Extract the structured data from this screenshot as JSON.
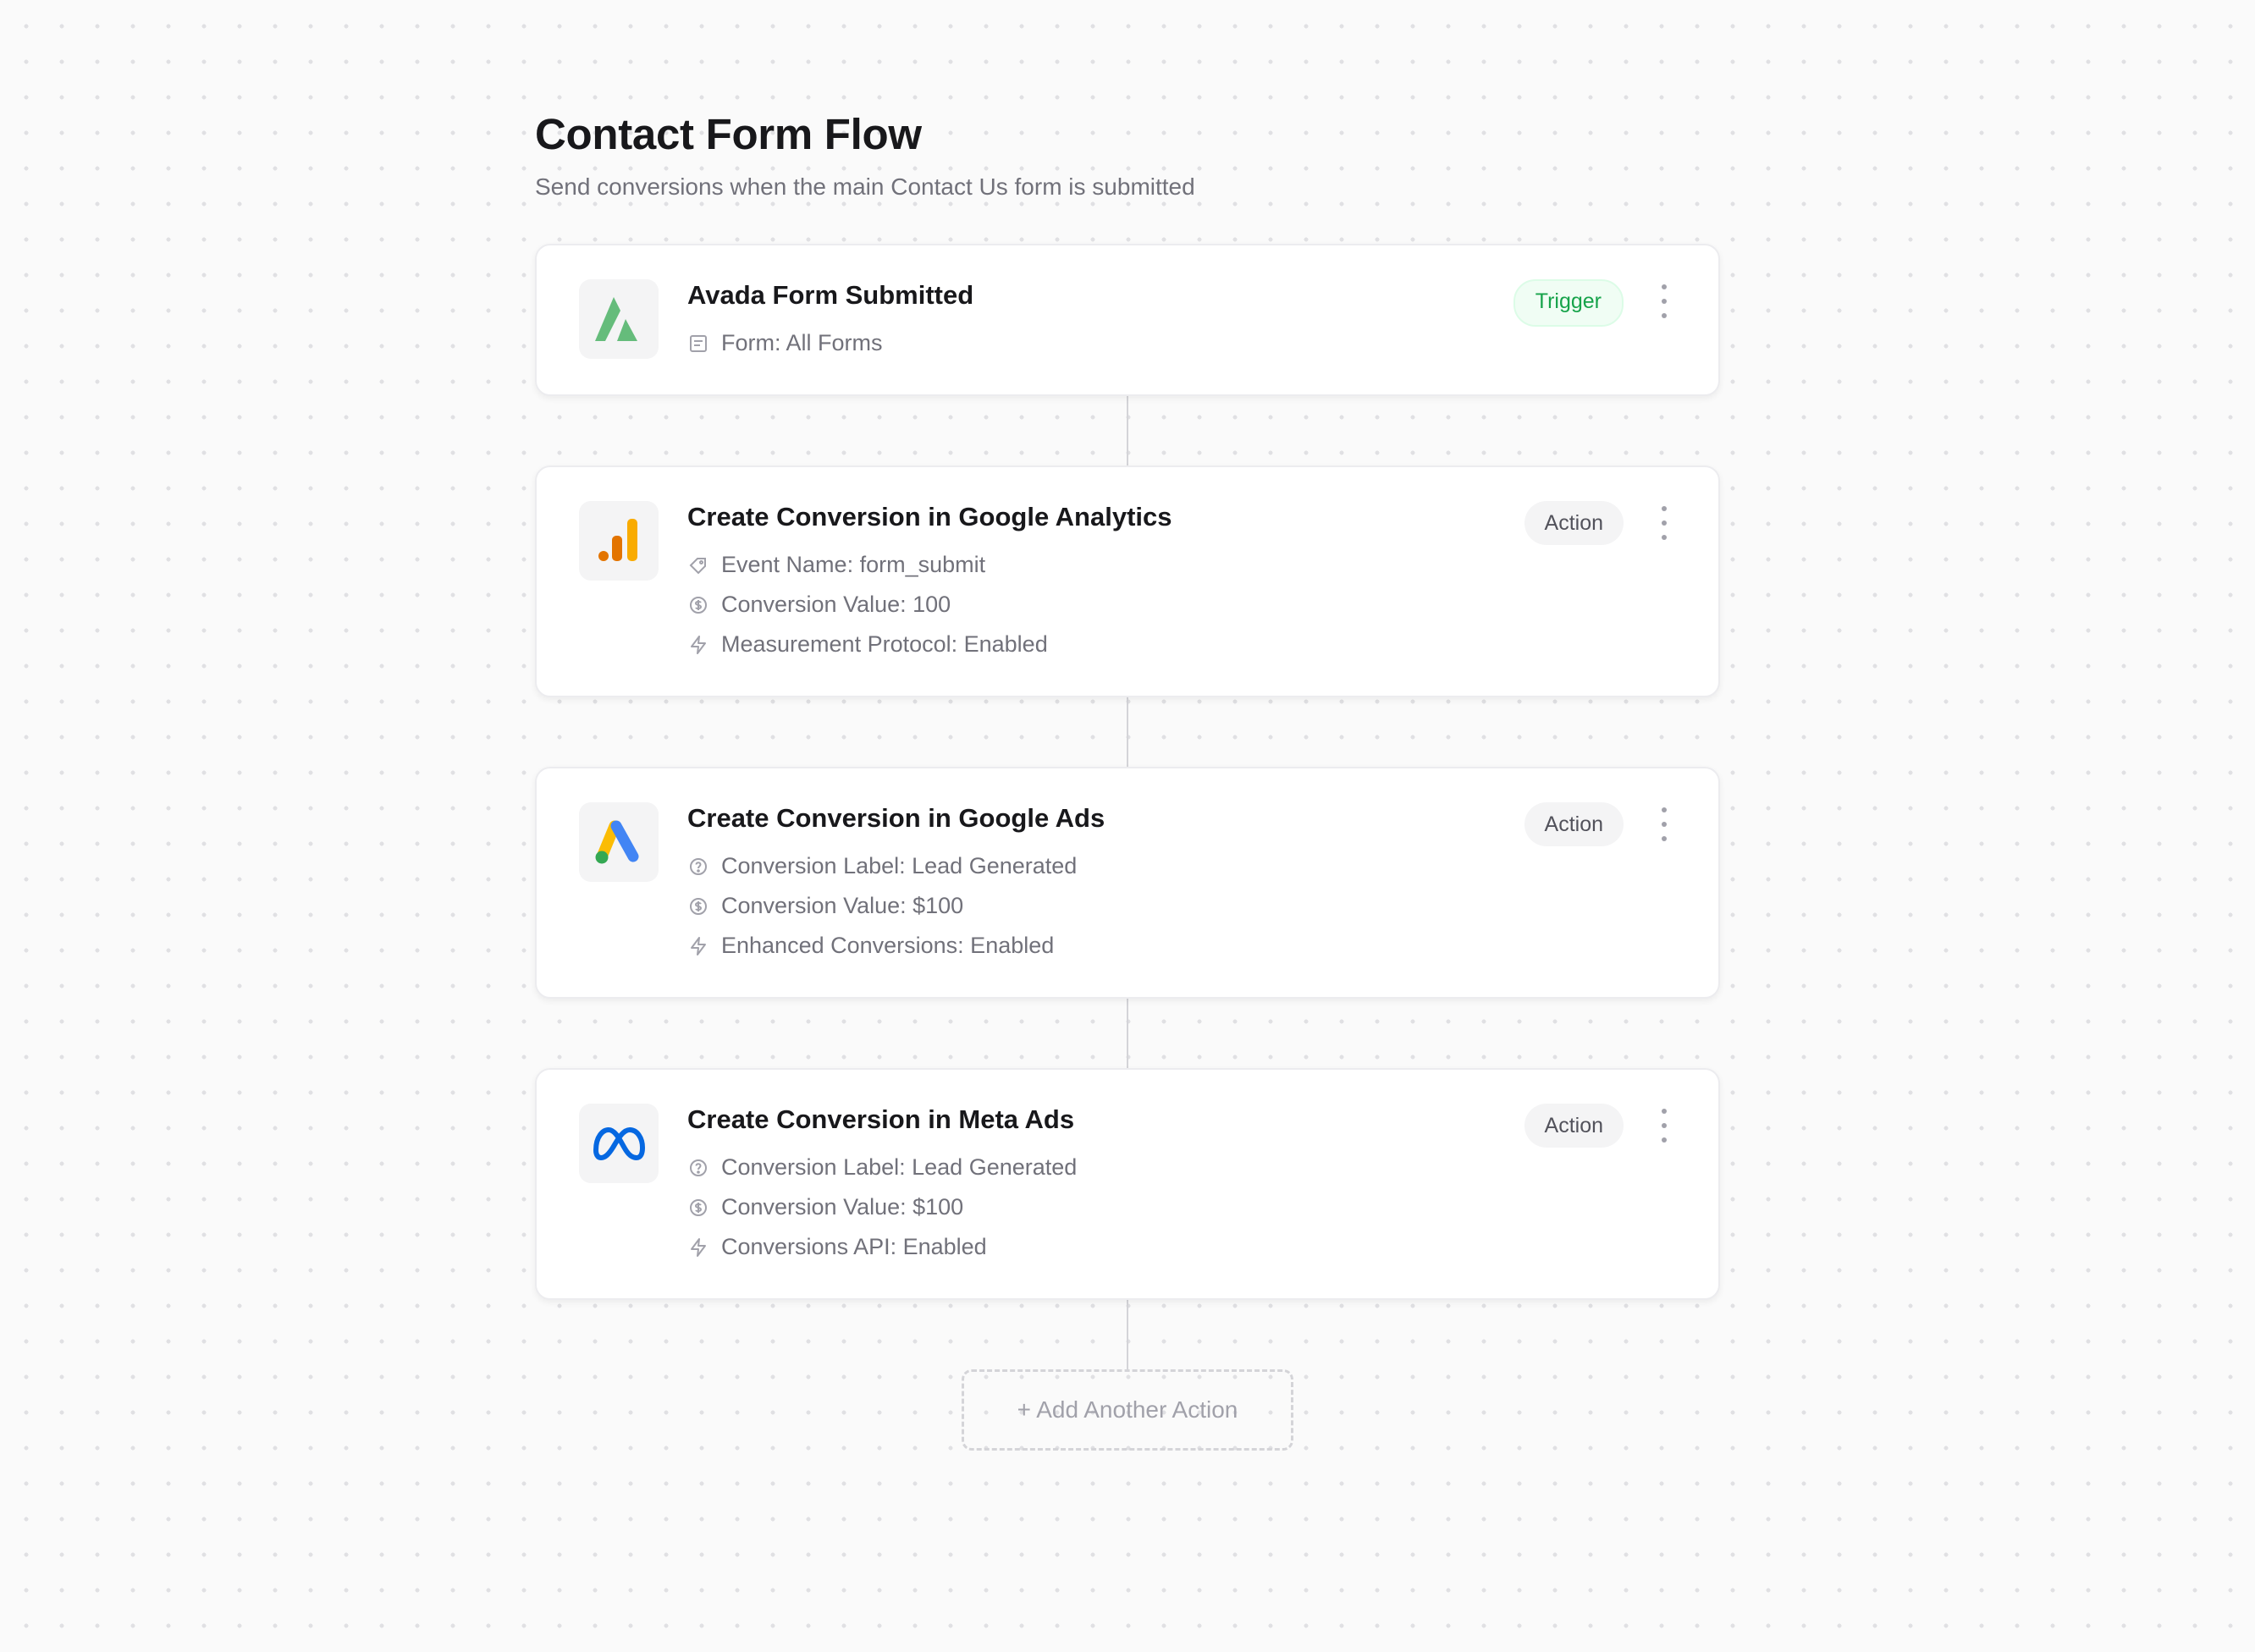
{
  "page": {
    "title": "Contact Form Flow",
    "subtitle": "Send conversions when the main Contact Us form is submitted"
  },
  "trigger": {
    "title": "Avada Form Submitted",
    "badge": "Trigger",
    "icon": "avada-logo-icon",
    "details": [
      {
        "icon": "form-icon",
        "text": "Form: All Forms"
      }
    ]
  },
  "actions": [
    {
      "title": "Create Conversion in Google Analytics",
      "badge": "Action",
      "icon": "google-analytics-logo-icon",
      "details": [
        {
          "icon": "tag-icon",
          "text": "Event Name: form_submit"
        },
        {
          "icon": "dollar-circle-icon",
          "text": "Conversion Value: 100"
        },
        {
          "icon": "lightning-icon",
          "text": "Measurement Protocol: Enabled"
        }
      ]
    },
    {
      "title": "Create Conversion in Google Ads",
      "badge": "Action",
      "icon": "google-ads-logo-icon",
      "details": [
        {
          "icon": "help-circle-icon",
          "text": "Conversion Label: Lead Generated"
        },
        {
          "icon": "dollar-circle-icon",
          "text": "Conversion Value: $100"
        },
        {
          "icon": "lightning-icon",
          "text": "Enhanced Conversions: Enabled"
        }
      ]
    },
    {
      "title": "Create Conversion in Meta Ads",
      "badge": "Action",
      "icon": "meta-logo-icon",
      "details": [
        {
          "icon": "help-circle-icon",
          "text": "Conversion Label: Lead Generated"
        },
        {
          "icon": "dollar-circle-icon",
          "text": "Conversion Value: $100"
        },
        {
          "icon": "lightning-icon",
          "text": "Conversions API: Enabled"
        }
      ]
    }
  ],
  "add_action": {
    "label": "+ Add Another Action"
  },
  "colors": {
    "trigger_green": "#16a34a",
    "avada_green": "#65bc7b",
    "ga_orange": "#e37400",
    "ga_yellow": "#f9ab00",
    "ads_blue": "#4285f4",
    "ads_yellow": "#fbbc04",
    "ads_green": "#34a853",
    "meta_blue": "#0668e1"
  }
}
